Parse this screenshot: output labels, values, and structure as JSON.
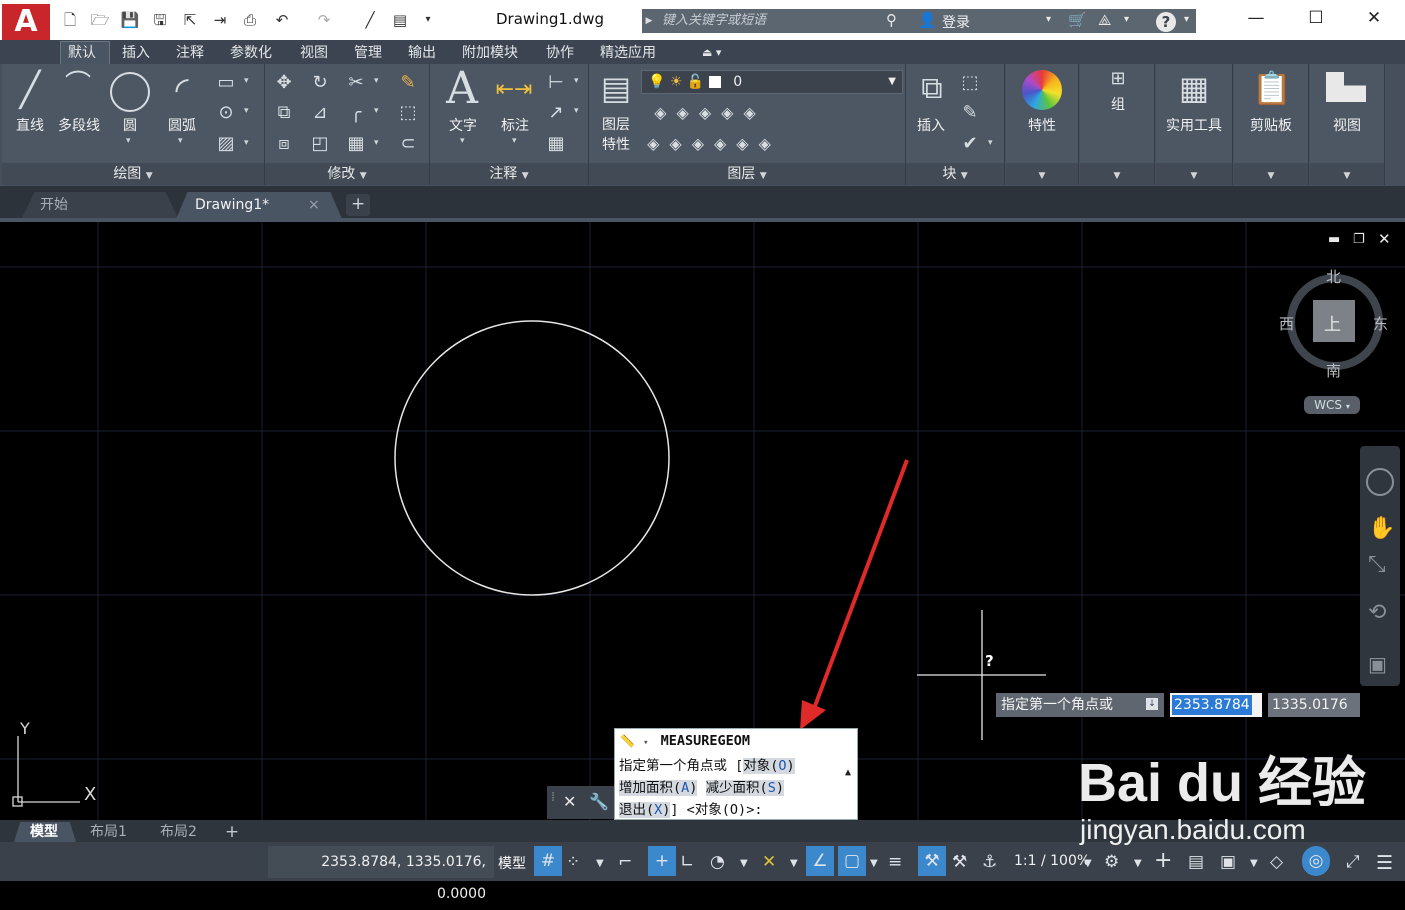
{
  "app": {
    "logo": "A",
    "doc_title": "Drawing1.dwg"
  },
  "search": {
    "placeholder": "键入关键字或短语"
  },
  "account": {
    "login_label": "登录"
  },
  "window_controls": {
    "minimize": "—",
    "maximize": "☐",
    "close": "✕"
  },
  "ribbon_tabs": [
    "默认",
    "插入",
    "注释",
    "参数化",
    "视图",
    "管理",
    "输出",
    "附加模块",
    "协作",
    "精选应用"
  ],
  "draw_panel": {
    "title": "绘图",
    "line": "直线",
    "polyline": "多段线",
    "circle": "圆",
    "arc": "圆弧"
  },
  "modify_panel": {
    "title": "修改"
  },
  "annotation_panel": {
    "title": "注释",
    "text": "文字",
    "dimension": "标注"
  },
  "layers_panel": {
    "title": "图层",
    "layer_props_line1": "图层",
    "layer_props_line2": "特性",
    "current_layer": "0"
  },
  "block_panel": {
    "title": "块",
    "insert": "插入"
  },
  "properties_panel": {
    "label": "特性"
  },
  "groups_panel": {
    "label": "组"
  },
  "utilities_panel": {
    "label": "实用工具"
  },
  "clipboard_panel": {
    "label": "剪贴板"
  },
  "view_panel": {
    "label": "视图"
  },
  "doc_tabs": {
    "start": "开始",
    "drawing": "Drawing1*",
    "close_glyph": "×",
    "new_glyph": "+"
  },
  "viewcube": {
    "north": "北",
    "south": "南",
    "east": "东",
    "west": "西",
    "face": "上",
    "wcs": "WCS"
  },
  "ucs": {
    "x": "X",
    "y": "Y"
  },
  "cursor": {
    "tooltip_mark": "?"
  },
  "dynamic_input": {
    "prompt": "指定第一个角点或",
    "x_value": "2353.8784",
    "y_value": "1335.0176"
  },
  "command_line": {
    "command": "MEASUREGEOM",
    "line1_prefix": "指定第一个角点或 [",
    "opt_object": "对象(",
    "opt_object_key": "O",
    "opt_add_area": "增加面积(",
    "opt_add_key": "A",
    "opt_sub_area": "减少面积(",
    "opt_sub_key": "S",
    "opt_exit": "退出(",
    "opt_exit_key": "X",
    "close_paren": ")",
    "line3_suffix": "] <对象(O)>:"
  },
  "layout_tabs": [
    "模型",
    "布局1",
    "布局2"
  ],
  "status": {
    "coordinates": "2353.8784, 1335.0176, 0.0000",
    "model": "模型",
    "scale": "1:1 / 100%"
  },
  "watermark": {
    "brand": "Bai du 经验",
    "url": "jingyan.baidu.com"
  },
  "colors": {
    "ribbon_bg": "#464f5b",
    "canvas_bg": "#000000",
    "accent": "#2a7ad6",
    "arrow": "#e02a2a"
  }
}
